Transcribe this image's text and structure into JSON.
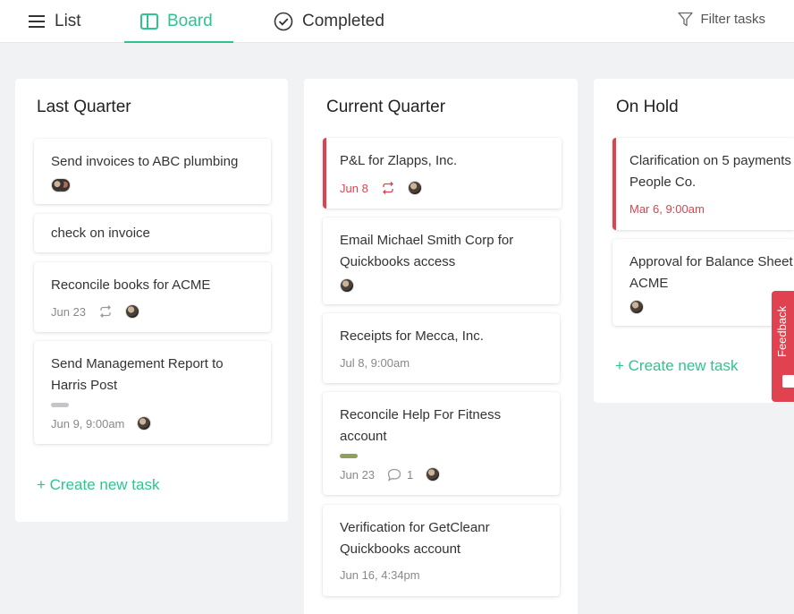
{
  "tabs": [
    {
      "label": "List",
      "icon": "hamburger-icon"
    },
    {
      "label": "Board",
      "icon": "board-icon",
      "active": true
    },
    {
      "label": "Completed",
      "icon": "check-circle-icon"
    }
  ],
  "filter": {
    "label": "Filter tasks",
    "icon": "funnel-icon"
  },
  "colors": {
    "accent": "#2ec490",
    "overdue": "#d9454f",
    "feedback": "#e0424f"
  },
  "columns": [
    {
      "title": "Last Quarter",
      "create_label": "+ Create new task",
      "cards": [
        {
          "title": "Send invoices to ABC plumbing"
        },
        {
          "title": "check on invoice"
        },
        {
          "title": "Reconcile books for ACME",
          "date": "Jun 23"
        },
        {
          "title": "Send Management Report to Harris Post",
          "date": "Jun 9, 9:00am"
        }
      ]
    },
    {
      "title": "Current Quarter",
      "cards": [
        {
          "title": "P&L for Zlapps, Inc.",
          "date": "Jun 8"
        },
        {
          "title": "Email Michael Smith Corp for Quickbooks access"
        },
        {
          "title": "Receipts for Mecca, Inc.",
          "date": "Jul 8, 9:00am"
        },
        {
          "title": "Reconcile Help For Fitness account",
          "date": "Jun 23",
          "comments": "1"
        },
        {
          "title": "Verification for GetCleanr Quickbooks account",
          "date": "Jun 16, 4:34pm"
        }
      ]
    },
    {
      "title": "On Hold",
      "create_label": "+ Create new task",
      "cards": [
        {
          "title": "Clarification on 5 payments People Co.",
          "date": "Mar 6, 9:00am"
        },
        {
          "title": "Approval for Balance Sheet ACME"
        }
      ]
    }
  ],
  "feedback": {
    "label": "Feedback"
  }
}
